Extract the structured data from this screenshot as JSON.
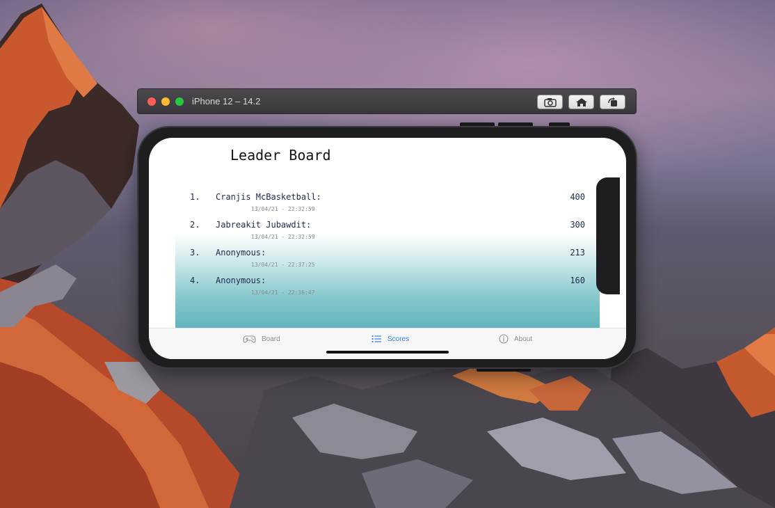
{
  "window": {
    "title": "iPhone 12 – 14.2",
    "buttons": [
      "screenshot-icon",
      "home-icon",
      "rotate-icon"
    ]
  },
  "app": {
    "header": "Leader Board",
    "scores": [
      {
        "rank": "1.",
        "name": "Cranjis McBasketball:",
        "score": "400",
        "date": "13/04/21 - 22:32:59"
      },
      {
        "rank": "2.",
        "name": "Jabreakit Jubawdit:",
        "score": "300",
        "date": "13/04/21 - 22:32:59"
      },
      {
        "rank": "3.",
        "name": "Anonymous:",
        "score": "213",
        "date": "13/04/21 - 22:37:25"
      },
      {
        "rank": "4.",
        "name": "Anonymous:",
        "score": "160",
        "date": "13/04/21 - 22:36:47"
      }
    ],
    "tabs": [
      {
        "label": "Board",
        "icon": "gamecontroller-icon",
        "active": false
      },
      {
        "label": "Scores",
        "icon": "list-icon",
        "active": true
      },
      {
        "label": "About",
        "icon": "info-icon",
        "active": false
      }
    ]
  },
  "colors": {
    "accent": "#2f7cf6",
    "gradient_bottom": "#60b5bc",
    "text": "#1b2a4e"
  }
}
